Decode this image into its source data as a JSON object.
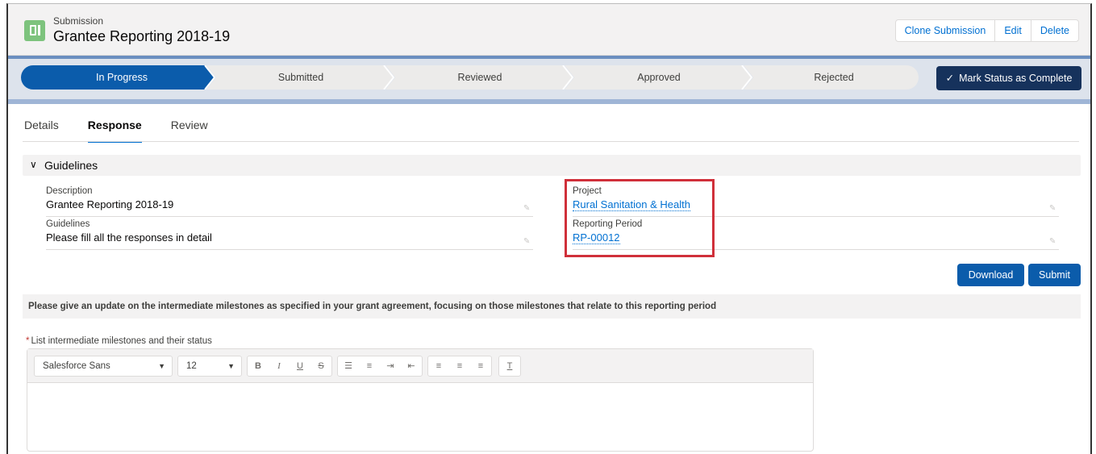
{
  "header": {
    "object_type": "Submission",
    "title": "Grantee Reporting 2018-19",
    "actions": [
      "Clone Submission",
      "Edit",
      "Delete"
    ]
  },
  "path": {
    "stages": [
      "In Progress",
      "Submitted",
      "Reviewed",
      "Approved",
      "Rejected"
    ],
    "active_index": 0,
    "mark_button": "Mark Status as Complete",
    "mark_icon": "check-icon"
  },
  "tabs": [
    "Details",
    "Response",
    "Review"
  ],
  "active_tab": "Response",
  "section": {
    "title": "Guidelines",
    "fields": {
      "description": {
        "label": "Description",
        "value": "Grantee Reporting 2018-19"
      },
      "guidelines": {
        "label": "Guidelines",
        "value": "Please fill all the responses in detail"
      },
      "project": {
        "label": "Project",
        "value": "Rural Sanitation & Health"
      },
      "reporting_period": {
        "label": "Reporting Period",
        "value": "RP-00012"
      }
    }
  },
  "buttons": {
    "download": "Download",
    "submit": "Submit"
  },
  "question": {
    "prompt": "Please give an update on the intermediate milestones as specified in your grant agreement, focusing on those milestones that relate to this reporting period",
    "field_label": "List intermediate milestones and their status",
    "required_marker": "*"
  },
  "editor": {
    "font_family": "Salesforce Sans",
    "font_size": "12",
    "format_buttons": [
      "B",
      "I",
      "U",
      "S"
    ]
  },
  "colors": {
    "accent": "#0b5cab",
    "highlight": "#d0303a",
    "link": "#0070d2"
  }
}
